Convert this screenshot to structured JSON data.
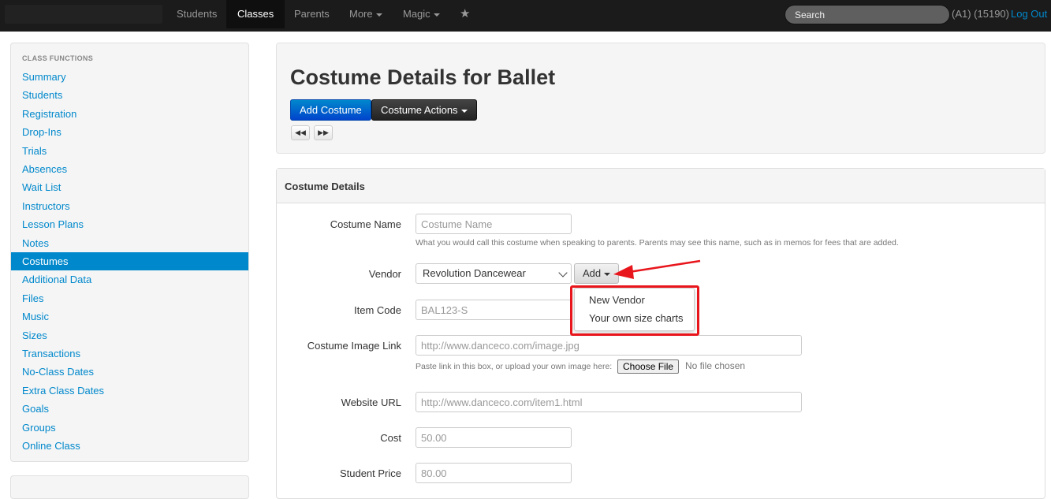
{
  "navbar": {
    "items": [
      "Students",
      "Classes",
      "Parents",
      "More",
      "Magic"
    ],
    "active": "Classes",
    "search_placeholder": "Search",
    "user_info": "(A1) (15190)",
    "logout_label": "Log Out"
  },
  "sidebar": {
    "header": "CLASS FUNCTIONS",
    "items": [
      "Summary",
      "Students",
      "Registration",
      "Drop-Ins",
      "Trials",
      "Absences",
      "Wait List",
      "Instructors",
      "Lesson Plans",
      "Notes",
      "Costumes",
      "Additional Data",
      "Files",
      "Music",
      "Sizes",
      "Transactions",
      "No-Class Dates",
      "Extra Class Dates",
      "Goals",
      "Groups",
      "Online Class"
    ],
    "active": "Costumes"
  },
  "header": {
    "title": "Costume Details for Ballet",
    "add_costume_label": "Add Costume",
    "costume_actions_label": "Costume Actions"
  },
  "panel": {
    "title": "Costume Details",
    "costume_name": {
      "label": "Costume Name",
      "placeholder": "Costume Name",
      "help": "What you would call this costume when speaking to parents. Parents may see this name, such as in memos for fees that are added."
    },
    "vendor": {
      "label": "Vendor",
      "value": "Revolution Dancewear",
      "add_label": "Add"
    },
    "item_code": {
      "label": "Item Code",
      "placeholder": "BAL123-S"
    },
    "image_link": {
      "label": "Costume Image Link",
      "placeholder": "http://www.danceco.com/image.jpg",
      "help": "Paste link in this box, or upload your own image here:",
      "choose_file_label": "Choose File",
      "no_file_label": "No file chosen"
    },
    "website_url": {
      "label": "Website URL",
      "placeholder": "http://www.danceco.com/item1.html"
    },
    "cost": {
      "label": "Cost",
      "placeholder": "50.00"
    },
    "student_price": {
      "label": "Student Price",
      "placeholder": "80.00"
    }
  },
  "dropdown": {
    "items": [
      "New Vendor",
      "Your own size charts"
    ]
  },
  "colors": {
    "accent": "#0088cc",
    "highlight": "#e8161c",
    "navbar": "#1b1b1b"
  }
}
